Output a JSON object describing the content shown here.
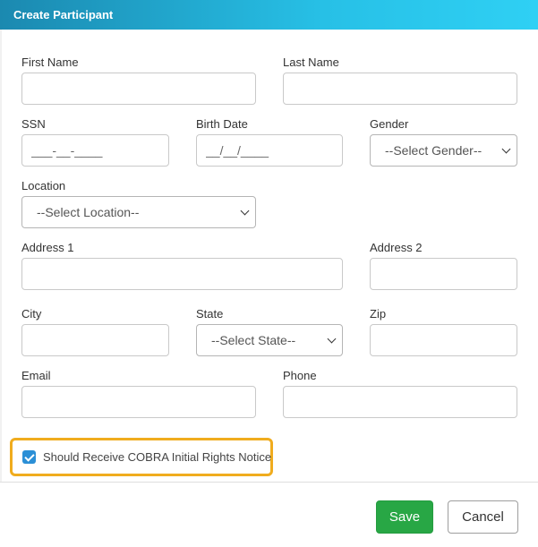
{
  "dialog": {
    "title": "Create Participant"
  },
  "form": {
    "first_name": {
      "label": "First Name",
      "value": ""
    },
    "last_name": {
      "label": "Last Name",
      "value": ""
    },
    "ssn": {
      "label": "SSN",
      "placeholder": "___-__-____"
    },
    "birth_date": {
      "label": "Birth Date",
      "placeholder": "__/__/____"
    },
    "gender": {
      "label": "Gender",
      "selected": "--Select Gender--"
    },
    "location": {
      "label": "Location",
      "selected": "--Select Location--"
    },
    "address1": {
      "label": "Address 1",
      "value": ""
    },
    "address2": {
      "label": "Address 2",
      "value": ""
    },
    "city": {
      "label": "City",
      "value": ""
    },
    "state": {
      "label": "State",
      "selected": "--Select State--"
    },
    "zip": {
      "label": "Zip",
      "value": ""
    },
    "email": {
      "label": "Email",
      "value": ""
    },
    "phone": {
      "label": "Phone",
      "value": ""
    },
    "cobra": {
      "label": "Should Receive COBRA Initial Rights Notice",
      "checked": true
    }
  },
  "footer": {
    "save_label": "Save",
    "cancel_label": "Cancel"
  },
  "colors": {
    "header_start": "#1b89b0",
    "header_end": "#2fd0f4",
    "save": "#28a745",
    "highlight": "#f0ac1e",
    "checkbox": "#2b8fd6"
  }
}
